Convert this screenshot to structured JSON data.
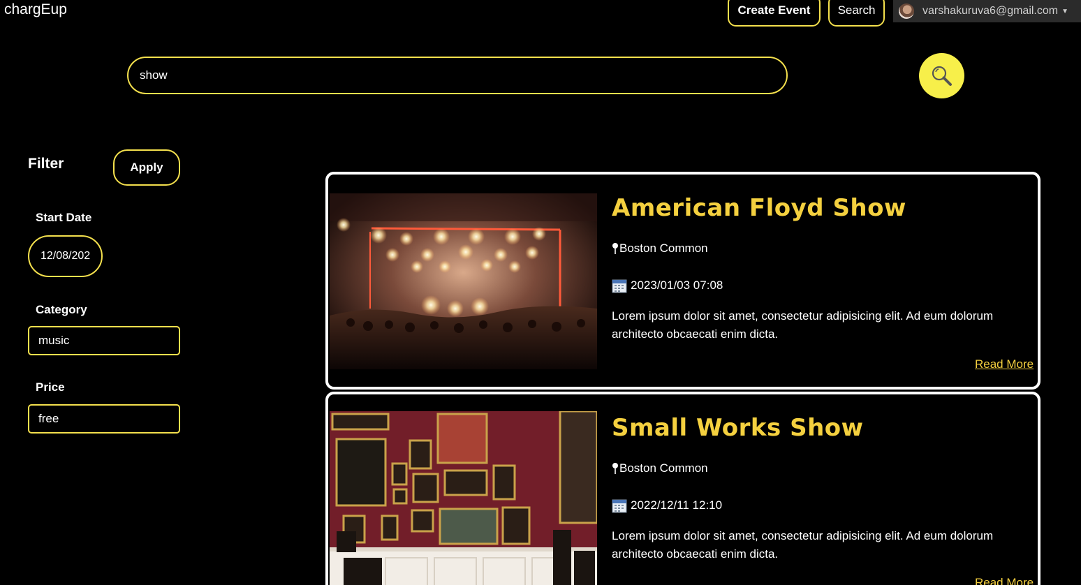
{
  "app": {
    "brand": "chargEup"
  },
  "header": {
    "create_event_label": "Create Event",
    "search_label": "Search",
    "account_email": "varshakuruva6@gmail.com"
  },
  "search": {
    "query": "show",
    "button_icon": "search-icon"
  },
  "filter": {
    "title": "Filter",
    "apply_label": "Apply",
    "start_date_label": "Start Date",
    "start_date_value": "12/08/202",
    "category_label": "Category",
    "category_value": "music",
    "price_label": "Price",
    "price_value": "free"
  },
  "events": [
    {
      "title": "American Floyd Show",
      "location": "Boston Common",
      "datetime": "2023/01/03 07:08",
      "description": "Lorem ipsum dolor sit amet, consectetur adipisicing elit. Ad eum dolorum architecto obcaecati enim dicta.",
      "read_more": "Read More",
      "image": "concert-stage-photo"
    },
    {
      "title": "Small Works Show",
      "location": "Boston Common",
      "datetime": "2022/12/11 12:10",
      "description": "Lorem ipsum dolor sit amet, consectetur adipisicing elit. Ad eum dolorum architecto obcaecati enim dicta.",
      "read_more": "Read More",
      "image": "art-gallery-photo"
    }
  ],
  "colors": {
    "accent": "#f4e04d",
    "title_yellow": "#f4d03f",
    "background": "#000000",
    "search_button": "#f7ef4a"
  }
}
